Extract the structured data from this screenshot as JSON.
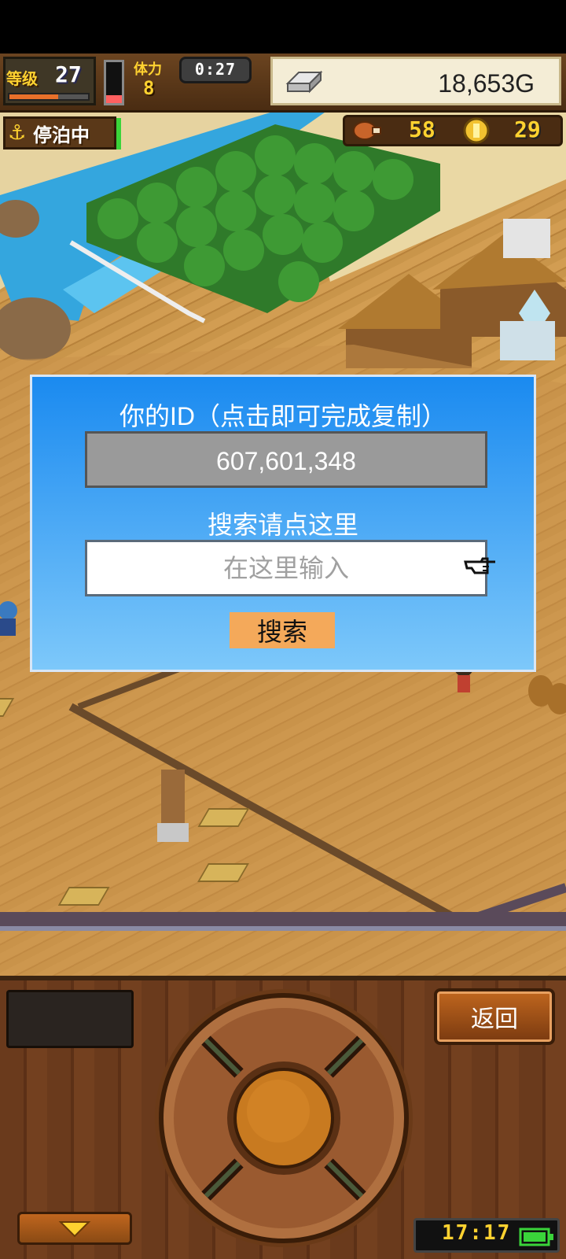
{
  "hud": {
    "level_label": "等级",
    "level": "27",
    "level_progress": 0.62,
    "stamina_level": 0.2,
    "stamina_label": "体力",
    "stamina": "8",
    "timer": "0:27",
    "gold": "18,653G",
    "status_label": "停泊中",
    "food": "58",
    "medals": "29"
  },
  "dialog": {
    "title": "你的ID（点击即可完成复制）",
    "id_value": "607,601,348",
    "search_heading": "搜索请点这里",
    "input_placeholder": "在这里输入",
    "input_value": "",
    "search_button": "搜索"
  },
  "controls": {
    "back_button": "返回"
  },
  "status": {
    "clock": "17:17"
  },
  "colors": {
    "dialog_blue": "#1a8af0",
    "gold_text": "#ffd230",
    "button_orange": "#f4a95a"
  },
  "icons": {
    "level": "level-badge",
    "stamina": "stamina-gauge",
    "gold": "silver-bar-icon",
    "anchor": "anchor-icon",
    "food": "roast-meat-icon",
    "medal": "gold-coin-icon",
    "pointer": "pointing-hand-icon",
    "down": "down-arrow-icon",
    "battery": "battery-icon"
  }
}
